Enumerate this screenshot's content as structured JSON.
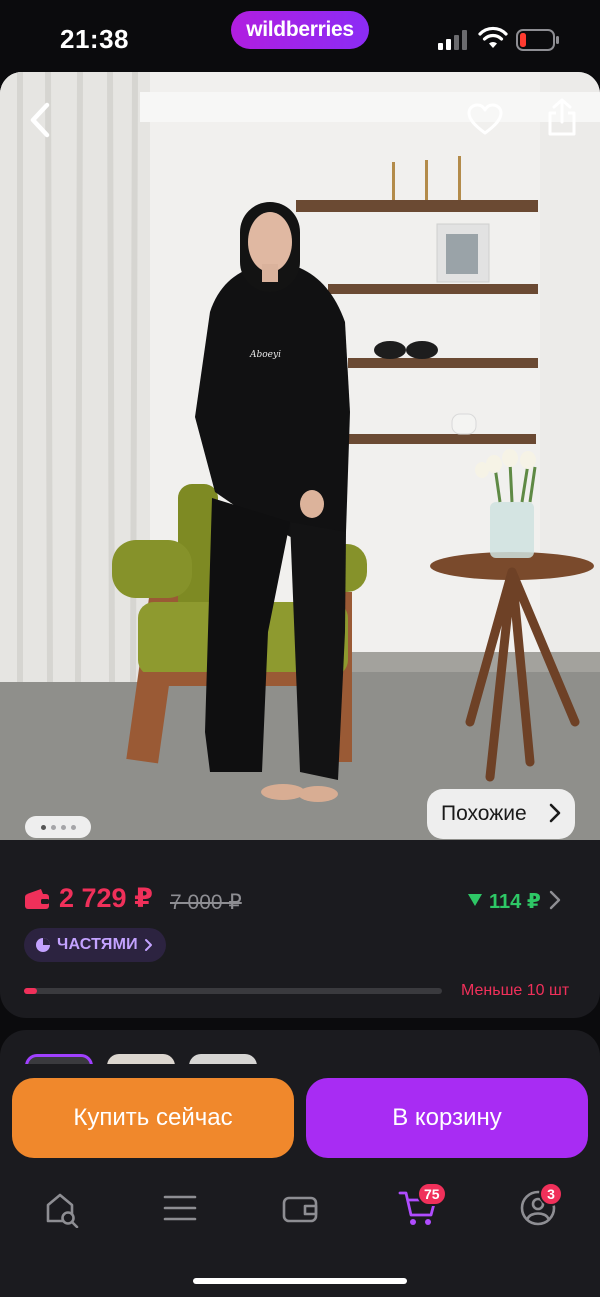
{
  "status": {
    "time": "21:38",
    "brand": "wildberries",
    "battery_color": "#ff3b30"
  },
  "hero": {
    "back_icon": "chevron-left-icon",
    "favorite_icon": "heart-outline-icon",
    "share_icon": "share-icon",
    "gallery_dots": 4,
    "active_dot": 1,
    "similar_label": "Похожие",
    "print_text": "Aboeyi"
  },
  "price": {
    "current": "2 729 ₽",
    "old": "7 000 ₽",
    "cashback": "114 ₽",
    "installments_label": "ЧАСТЯМИ",
    "stock_label": "Меньше 10 шт",
    "stock_level": 0.03,
    "accent_color": "#f0305a",
    "cashback_color": "#2ec766"
  },
  "actions": {
    "buy_now_label": "Купить сейчас",
    "add_to_cart_label": "В корзину",
    "buy_now_color": "#f0882c",
    "add_to_cart_color": "#a82cf3"
  },
  "nav": {
    "cart_badge": "75",
    "profile_badge": "3"
  }
}
